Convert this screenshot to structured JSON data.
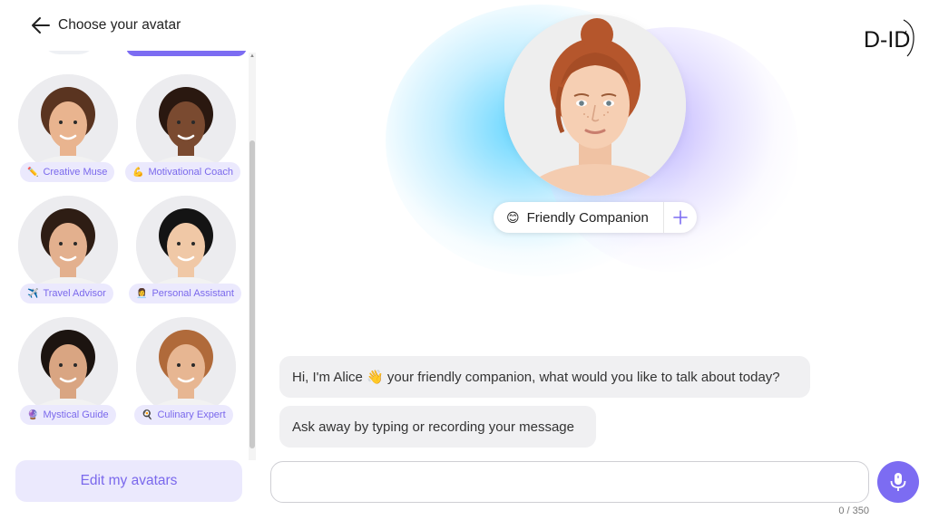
{
  "sidebar": {
    "title": "Choose your avatar",
    "avatars": [
      {
        "label": "Creative Muse",
        "emoji": "✏️",
        "skin": "#e9b48f",
        "hair": "#5a3420",
        "bg": "#ececef"
      },
      {
        "label": "Motivational Coach",
        "emoji": "💪",
        "skin": "#7a4a30",
        "hair": "#2a1810",
        "bg": "#ececef"
      },
      {
        "label": "Travel Advisor",
        "emoji": "✈️",
        "skin": "#e3b08e",
        "hair": "#2e1d14",
        "bg": "#ececef"
      },
      {
        "label": "Personal Assistant",
        "emoji": "👩‍💼",
        "skin": "#f0c8a6",
        "hair": "#141414",
        "bg": "#ececef"
      },
      {
        "label": "Mystical Guide",
        "emoji": "🔮",
        "skin": "#d9a582",
        "hair": "#1c1410",
        "bg": "#ececef"
      },
      {
        "label": "Culinary Expert",
        "emoji": "🍳",
        "skin": "#e7b692",
        "hair": "#b06a3a",
        "bg": "#ececef"
      }
    ],
    "edit_button": "Edit my avatars"
  },
  "main": {
    "companion": {
      "emoji": "😊",
      "name": "Friendly Companion"
    },
    "logo_text": "D-ID",
    "messages": [
      {
        "text": "Hi, I'm Alice 👋 your friendly companion, what would you like to talk about today?"
      },
      {
        "text": "Ask away by typing or recording your message"
      }
    ],
    "input": {
      "value": "",
      "placeholder": ""
    },
    "char_counter": "0 / 350"
  },
  "colors": {
    "accent": "#7c6cf2",
    "label_bg": "#ebe9fd",
    "label_text": "#7a68ec",
    "bubble_bg": "#f0f0f2"
  },
  "icons": {
    "back": "arrow-left-icon",
    "plus": "plus-icon",
    "mic": "microphone-icon"
  }
}
